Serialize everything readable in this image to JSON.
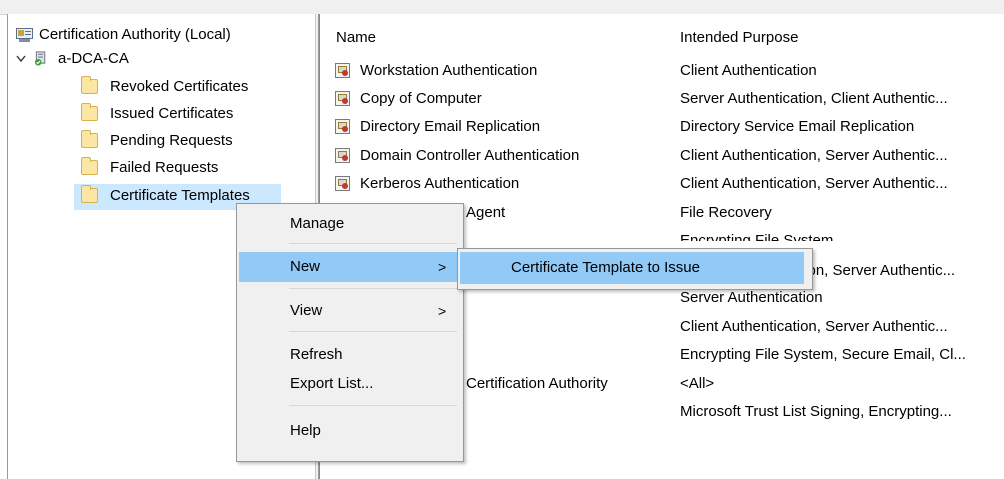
{
  "tree": {
    "root_label": "Certification Authority (Local)",
    "ca_label": "a-DCA-CA",
    "folders": [
      {
        "label": "Revoked Certificates"
      },
      {
        "label": "Issued Certificates"
      },
      {
        "label": "Pending Requests"
      },
      {
        "label": "Failed Requests"
      },
      {
        "label": "Certificate Templates"
      }
    ]
  },
  "list": {
    "columns": {
      "name": "Name",
      "purpose": "Intended Purpose"
    },
    "rows": [
      {
        "name": "Workstation Authentication",
        "purpose": "Client Authentication"
      },
      {
        "name": "Copy of Computer",
        "purpose": "Server Authentication, Client Authentic..."
      },
      {
        "name": "Directory Email Replication",
        "purpose": "Directory Service Email Replication"
      },
      {
        "name": "Domain Controller Authentication",
        "purpose": "Client Authentication, Server Authentic..."
      },
      {
        "name": "Kerberos Authentication",
        "purpose": "Client Authentication, Server Authentic..."
      },
      {
        "name": "Agent",
        "purpose": "File Recovery"
      },
      {
        "name": "",
        "purpose": "Encrypting File System"
      },
      {
        "name": "",
        "purpose": "tion, Server Authentic..."
      },
      {
        "name": "",
        "purpose": "Server Authentication"
      },
      {
        "name": "",
        "purpose": "Client Authentication, Server Authentic..."
      },
      {
        "name": "",
        "purpose": "Encrypting File System, Secure Email, Cl..."
      },
      {
        "name": "Certification Authority",
        "purpose": "<All>"
      },
      {
        "name": "",
        "purpose": "Microsoft Trust List Signing, Encrypting..."
      }
    ]
  },
  "context_menu": {
    "manage": "Manage",
    "new": "New",
    "view": "View",
    "refresh": "Refresh",
    "export_list": "Export List...",
    "help": "Help",
    "submenu_arrow": ">"
  },
  "submenu": {
    "issue_template": "Certificate Template to Issue"
  },
  "colors": {
    "selection": "#cce8ff",
    "menu_highlight": "#91c9f7",
    "menu_bg": "#f0f0f0"
  }
}
